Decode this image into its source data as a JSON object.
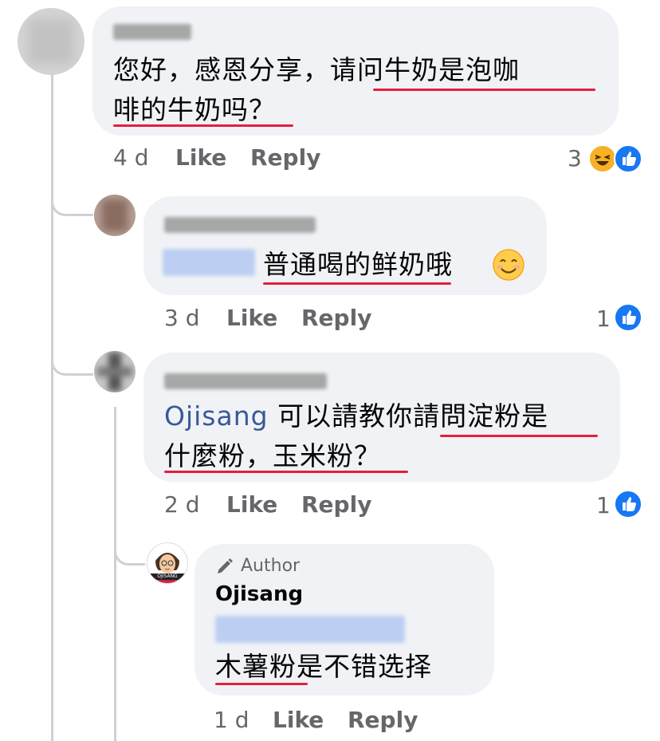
{
  "comments": [
    {
      "text_line1_a": "您好，感恩分享，",
      "text_line1_b": "请问牛奶是泡咖",
      "text_line2": "啡的牛奶吗？",
      "time": "4 d",
      "like": "Like",
      "reply": "Reply",
      "reaction_count": "3"
    },
    {
      "text": "普通喝的鲜奶哦",
      "emoji": "😊",
      "time": "3 d",
      "like": "Like",
      "reply": "Reply",
      "reaction_count": "1"
    },
    {
      "mention": "Ojisang",
      "text_line1_a": " 可以請教你",
      "text_line1_b": "請問淀粉是",
      "text_line2": "什麼粉，玉米粉？",
      "time": "2 d",
      "like": "Like",
      "reply": "Reply",
      "reaction_count": "1"
    },
    {
      "badge": "Author",
      "name": "Ojisang",
      "avatar_text": "OJISANG",
      "text_a": "木薯粉",
      "text_b": "是不错选择",
      "time": "1 d",
      "like": "Like",
      "reply": "Reply"
    }
  ],
  "colors": {
    "bubble": "#f0f2f5",
    "underline": "#e41e3f",
    "mention": "#385898",
    "like_blue": "#1877f2"
  },
  "icons": [
    "like-reaction-icon",
    "haha-reaction-icon",
    "smile-emoji-icon",
    "pencil-icon"
  ]
}
